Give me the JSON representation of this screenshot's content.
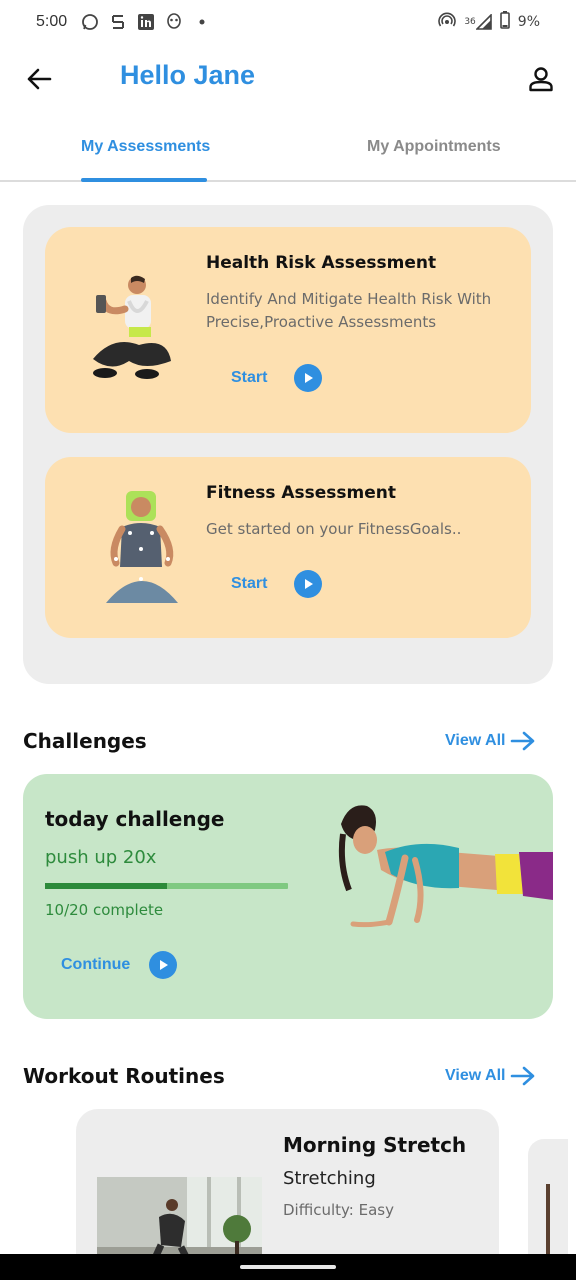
{
  "status_bar": {
    "time": "5:00",
    "network": "36",
    "battery": "9%"
  },
  "header": {
    "greeting": "Hello Jane"
  },
  "tabs": [
    {
      "label": "My Assessments",
      "active": true
    },
    {
      "label": "My Appointments",
      "active": false
    }
  ],
  "assessments": [
    {
      "title": "Health Risk Assessment",
      "description": "Identify  And Mitigate Health Risk With Precise,Proactive Assessments",
      "action": "Start"
    },
    {
      "title": "Fitness Assessment",
      "description": "Get started on your FitnessGoals..",
      "action": "Start"
    }
  ],
  "challenges": {
    "section_title": "Challenges",
    "view_all": "View All",
    "card": {
      "title": "today challenge",
      "task": "push up 20x",
      "progress": 0.5,
      "count_text": "10/20 complete",
      "action": "Continue"
    }
  },
  "workouts": {
    "section_title": "Workout Routines",
    "view_all": "View All",
    "items": [
      {
        "title": "Morning Stretch",
        "type": "Stretching",
        "difficulty": "Difficulty: Easy"
      }
    ]
  },
  "colors": {
    "accent": "#2f8fe0",
    "assessment_card": "#fde0b1",
    "challenge_card": "#c7e6c8",
    "panel": "#ededed",
    "success": "#2e8b3d"
  }
}
